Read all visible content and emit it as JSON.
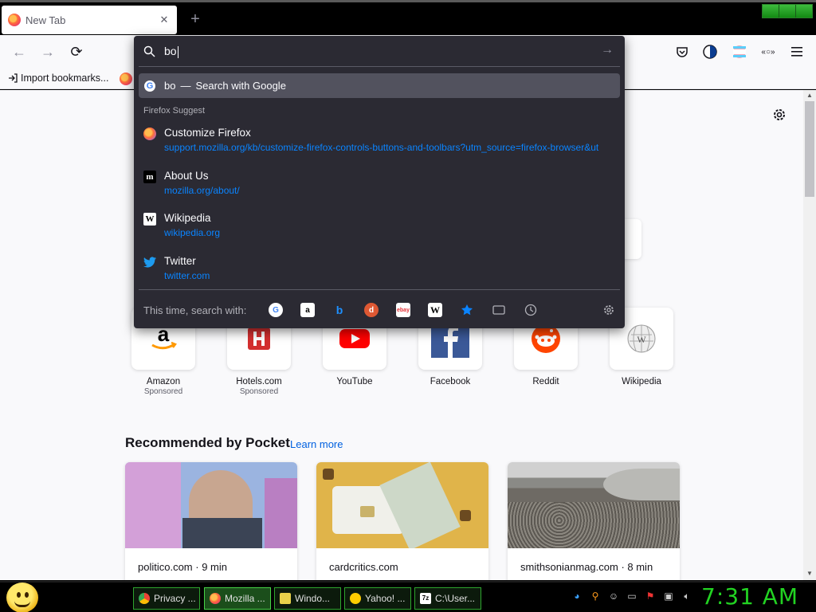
{
  "browser": {
    "tab_title": "New Tab",
    "tab_close": "✕",
    "new_tab": "+"
  },
  "navbar": {
    "back": "←",
    "forward": "→",
    "reload": "⟳"
  },
  "bookmarks": {
    "import_label": "Import bookmarks..."
  },
  "urlbar": {
    "typed": "bo",
    "go": "→",
    "search_row": {
      "query": "bo",
      "dash": "—",
      "action": "Search with Google"
    },
    "suggest_heading": "Firefox Suggest",
    "suggestions": [
      {
        "title": "Customize Firefox",
        "url": "support.mozilla.org/kb/customize-firefox-controls-buttons-and-toolbars?utm_source=firefox-browser&ut",
        "icon": "firefox-icon"
      },
      {
        "title": "About Us",
        "url": "mozilla.org/about/",
        "icon": "mozilla-icon"
      },
      {
        "title": "Wikipedia",
        "url": "wikipedia.org",
        "icon": "wikipedia-icon"
      },
      {
        "title": "Twitter",
        "url": "twitter.com",
        "icon": "twitter-icon"
      }
    ],
    "engines_label": "This time, search with:",
    "engines": [
      "google",
      "amazon",
      "bing",
      "duckduckgo",
      "ebay",
      "wikipedia",
      "bookmarks",
      "tabs",
      "history",
      "settings"
    ]
  },
  "shortcuts": [
    {
      "label": "Amazon",
      "sponsor": "Sponsored",
      "icon": "amazon-logo"
    },
    {
      "label": "Hotels.com",
      "sponsor": "Sponsored",
      "icon": "hotels-logo"
    },
    {
      "label": "YouTube",
      "sponsor": "",
      "icon": "youtube-logo"
    },
    {
      "label": "Facebook",
      "sponsor": "",
      "icon": "facebook-logo"
    },
    {
      "label": "Reddit",
      "sponsor": "",
      "icon": "reddit-logo"
    },
    {
      "label": "Wikipedia",
      "sponsor": "",
      "icon": "wikipedia-logo"
    }
  ],
  "pocket": {
    "heading": "Recommended by Pocket",
    "learn_more": "Learn more",
    "cards": [
      {
        "source": "politico.com · 9 min"
      },
      {
        "source": "cardcritics.com"
      },
      {
        "source": "smithsonianmag.com · 8 min"
      }
    ]
  },
  "taskbar": {
    "tasks": [
      {
        "label": "Privacy ...",
        "color": "#4285f4"
      },
      {
        "label": "Mozilla ...",
        "color": "#ff7139"
      },
      {
        "label": "Windo...",
        "color": "#e8d14a"
      },
      {
        "label": "Yahoo! ...",
        "color": "#ffcc00"
      },
      {
        "label": "C:\\User...",
        "color": "#ffffff"
      }
    ],
    "clock": "7:31 AM"
  },
  "colors": {
    "popup_bg": "#2b2a33",
    "link_blue": "#0a84ff",
    "clock_green": "#22d322"
  }
}
